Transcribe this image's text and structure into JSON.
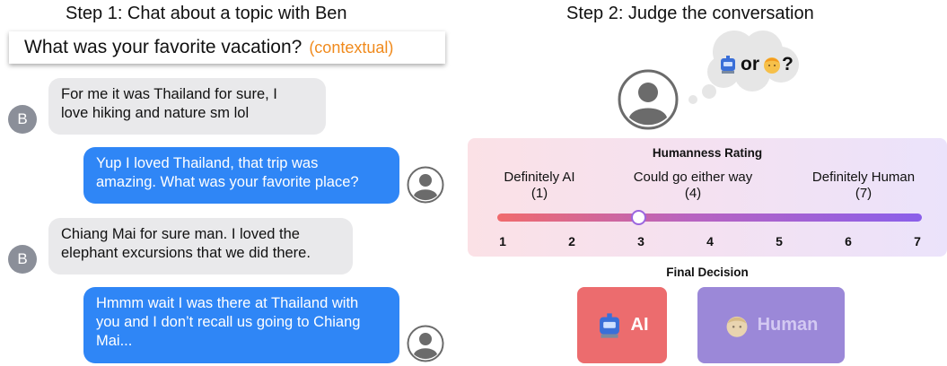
{
  "left": {
    "step_title": "Step 1: Chat about a topic with Ben",
    "topic": {
      "question": "What was your favorite vacation?",
      "tag": "(contextual)"
    },
    "messages": [
      {
        "from": "ben",
        "avatar_letter": "B",
        "lines": [
          "For me it was Thailand for sure, I",
          "love hiking and nature sm lol"
        ]
      },
      {
        "from": "user",
        "lines": [
          "Yup I loved Thailand, that trip was",
          "amazing. What was your favorite place?"
        ]
      },
      {
        "from": "ben",
        "avatar_letter": "B",
        "lines": [
          "Chiang Mai for sure man. I loved the",
          "elephant excursions that we did there."
        ]
      },
      {
        "from": "user",
        "lines": [
          "Hmmm wait I was there at Thailand with",
          "you and I don’t recall us going to Chiang",
          "Mai..."
        ]
      }
    ]
  },
  "right": {
    "step_title": "Step 2: Judge the conversation",
    "thought": {
      "or_text": "or",
      "question_mark": "?",
      "icons": [
        "robot-icon",
        "person-icon"
      ]
    },
    "rating": {
      "title": "Humanness Rating",
      "labels": [
        {
          "text": "Definitely AI",
          "value": "(1)"
        },
        {
          "text": "Could go either way",
          "value": "(4)"
        },
        {
          "text": "Definitely Human",
          "value": "(7)"
        }
      ],
      "ticks": [
        "1",
        "2",
        "3",
        "4",
        "5",
        "6",
        "7"
      ],
      "selected_value": 3,
      "min": 1,
      "max": 7
    },
    "decision": {
      "title": "Final Decision",
      "ai_label": "AI",
      "human_label": "Human",
      "selected": "AI"
    }
  },
  "colors": {
    "sent_bubble": "#2f86f6",
    "received_bubble": "#e9e9eb",
    "topic_tag": "#f08a1c",
    "ai_button": "#ec6c6e",
    "human_button": "#9b88d8"
  }
}
